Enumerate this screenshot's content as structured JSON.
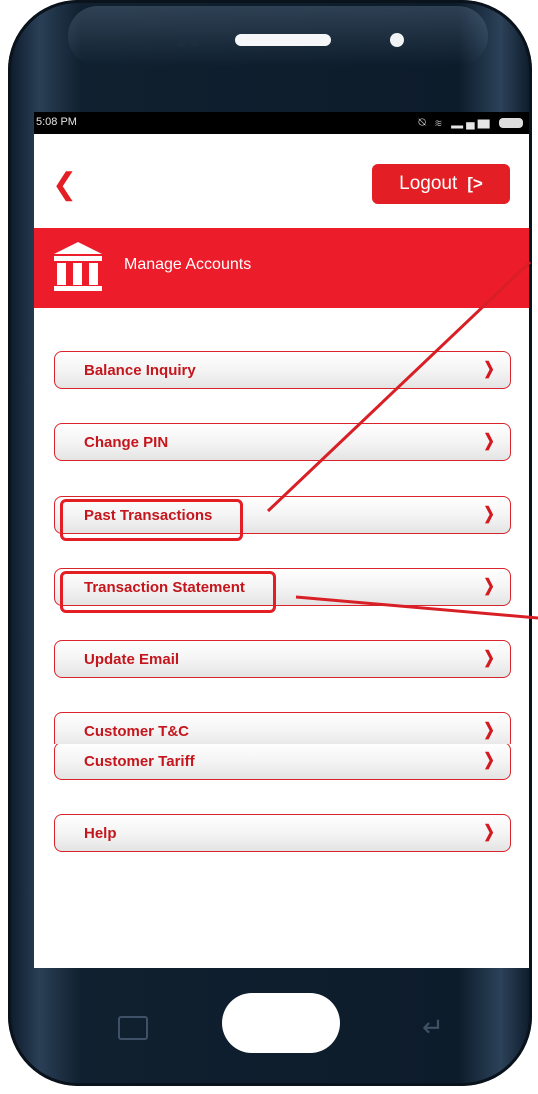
{
  "status_bar": {
    "time": "5:08 PM",
    "icons": [
      "alarm-muted-icon",
      "wifi-icon",
      "signal-icon",
      "battery-icon"
    ]
  },
  "header": {
    "back_icon": "chevron-left-icon",
    "logout_label": "Logout",
    "logout_icon": "logout-icon"
  },
  "banner": {
    "title": "Manage Accounts",
    "icon": "bank-icon"
  },
  "menu": {
    "items": [
      {
        "label": "Balance Inquiry"
      },
      {
        "label": "Change PIN"
      },
      {
        "label": "Past Transactions"
      },
      {
        "label": "Transaction Statement"
      },
      {
        "label": "Update Email"
      },
      {
        "label": "Customer T&C"
      },
      {
        "label": "Customer Tariff"
      },
      {
        "label": "Help"
      }
    ],
    "chevron_icon": "chevron-right-icon"
  },
  "colors": {
    "accent": "#e31e24",
    "banner": "#ec1c2a",
    "label": "#c4161c"
  }
}
